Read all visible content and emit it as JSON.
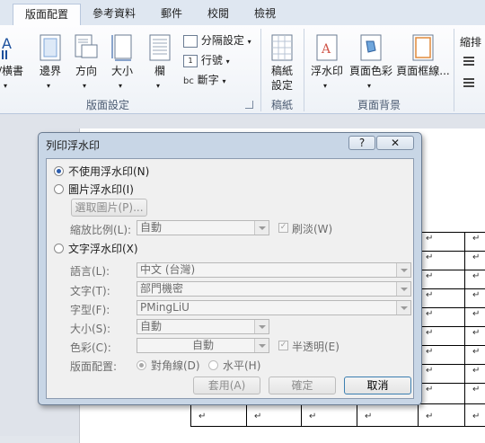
{
  "ribbon": {
    "tabs": [
      "版面配置",
      "參考資料",
      "郵件",
      "校閱",
      "檢視"
    ],
    "buttons": {
      "text_direction": "/横書",
      "margins": "邊界",
      "orientation": "方向",
      "size": "大小",
      "columns": "欄",
      "breaks": "分隔設定",
      "line_numbers": "行號",
      "hyphenation": "斷字",
      "draft_line1": "稿紙",
      "draft_line2": "設定",
      "watermark": "浮水印",
      "page_color": "頁面色彩",
      "page_borders": "頁面框線...",
      "indent": "縮排"
    },
    "groups": {
      "page_setup": "版面設定",
      "draft": "稿紙",
      "page_background": "頁面背景"
    }
  },
  "dialog": {
    "title": "列印浮水印",
    "help": "?",
    "close": "✕",
    "no_watermark": "不使用浮水印(N)",
    "picture_watermark": "圖片浮水印(I)",
    "select_picture": "選取圖片(P)...",
    "scale_label": "縮放比例(L):",
    "scale_value": "自動",
    "washout": "刷淡(W)",
    "text_watermark": "文字浮水印(X)",
    "language_label": "語言(L):",
    "language_value": "中文 (台灣)",
    "text_label": "文字(T):",
    "text_value": "部門機密",
    "font_label": "字型(F):",
    "font_value": "PMingLiU",
    "size_label": "大小(S):",
    "size_value": "自動",
    "color_label": "色彩(C):",
    "color_value": "自動",
    "semitransparent": "半透明(E)",
    "layout_label": "版面配置:",
    "diagonal": "對角線(D)",
    "horizontal": "水平(H)",
    "apply": "套用(A)",
    "ok": "確定",
    "cancel": "取消"
  },
  "document": {
    "cell_mark": "↵"
  }
}
